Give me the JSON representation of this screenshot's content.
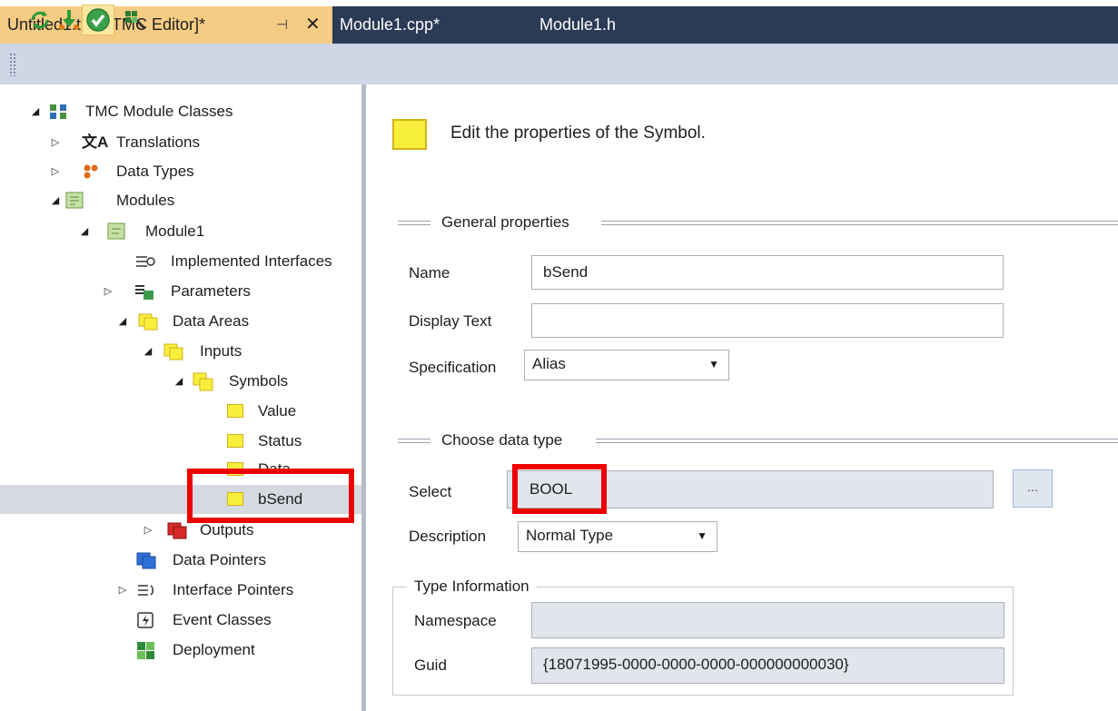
{
  "tabs": [
    {
      "label": "Untitled1.tmc [TMC Editor]*",
      "active": true
    },
    {
      "label": "Module1.cpp*",
      "active": false
    },
    {
      "label": "Module1.h",
      "active": false
    }
  ],
  "tab_icons": {
    "pin": "⊣",
    "close": "✕"
  },
  "toolbar": {
    "buttons": [
      "refresh-icon",
      "import-icon",
      "check-icon",
      "tool-icon"
    ]
  },
  "tree": {
    "root": "TMC Module Classes",
    "translations": "Translations",
    "data_types": "Data Types",
    "modules": "Modules",
    "module1": "Module1",
    "implemented_interfaces": "Implemented Interfaces",
    "parameters": "Parameters",
    "data_areas": "Data Areas",
    "inputs": "Inputs",
    "symbols": "Symbols",
    "value": "Value",
    "status": "Status",
    "data": "Data",
    "bsend": "bSend",
    "outputs": "Outputs",
    "data_pointers": "Data Pointers",
    "interface_pointers": "Interface Pointers",
    "event_classes": "Event Classes",
    "deployment": "Deployment",
    "selected": "bSend"
  },
  "panel": {
    "heading": "Edit the properties of the Symbol.",
    "general": {
      "title": "General properties",
      "name_label": "Name",
      "name_value": "bSend",
      "display_label": "Display Text",
      "display_value": "",
      "spec_label": "Specification",
      "spec_value": "Alias"
    },
    "datatype": {
      "title": "Choose data type",
      "select_label": "Select",
      "select_value": "BOOL",
      "browse_label": "...",
      "desc_label": "Description",
      "desc_value": "Normal Type"
    },
    "typeinfo": {
      "title": "Type Information",
      "namespace_label": "Namespace",
      "namespace_value": "",
      "guid_label": "Guid",
      "guid_value": "{18071995-0000-0000-0000-000000000030}"
    }
  },
  "colors": {
    "accent_tab": "#f5cc84",
    "highlight_box": "#ee0000",
    "tab_bar": "#2b3a55"
  }
}
